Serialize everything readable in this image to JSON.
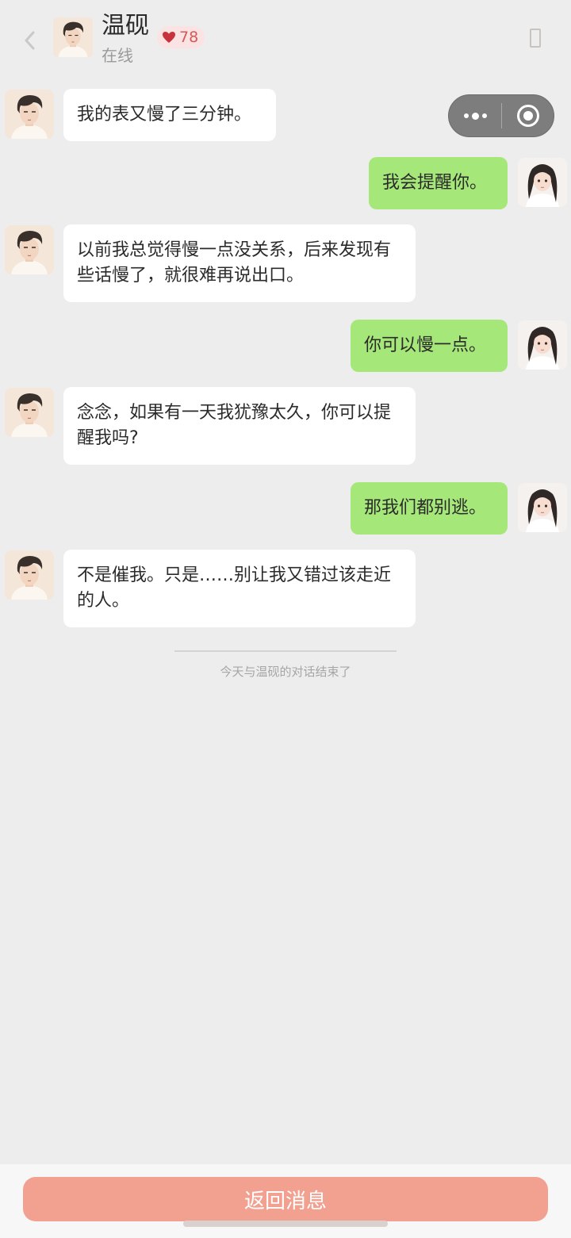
{
  "header": {
    "name": "温砚",
    "status": "在线",
    "affinity": "78",
    "colors": {
      "heart": "#c8323c",
      "affinity_text": "#d45a5a"
    }
  },
  "messages": [
    {
      "side": "in",
      "text": "我的表又慢了三分钟。"
    },
    {
      "side": "out",
      "text": "我会提醒你。"
    },
    {
      "side": "in",
      "text": "以前我总觉得慢一点没关系，后来发现有些话慢了，就很难再说出口。"
    },
    {
      "side": "out",
      "text": "你可以慢一点。"
    },
    {
      "side": "in",
      "text": "念念，如果有一天我犹豫太久，你可以提醒我吗?"
    },
    {
      "side": "out",
      "text": "那我们都别逃。"
    },
    {
      "side": "in",
      "text": "不是催我。只是……别让我又错过该走近的人。"
    }
  ],
  "end_note": "今天与温砚的对话结束了",
  "return_button": "返回消息",
  "colors": {
    "background": "#ededed",
    "bubble_in": "#ffffff",
    "bubble_out": "#a5e879",
    "return_button": "#f2a090"
  },
  "icons": {
    "back": "chevron-left-icon",
    "heart": "heart-icon",
    "more": "more-dots-icon",
    "close": "target-circle-icon"
  }
}
